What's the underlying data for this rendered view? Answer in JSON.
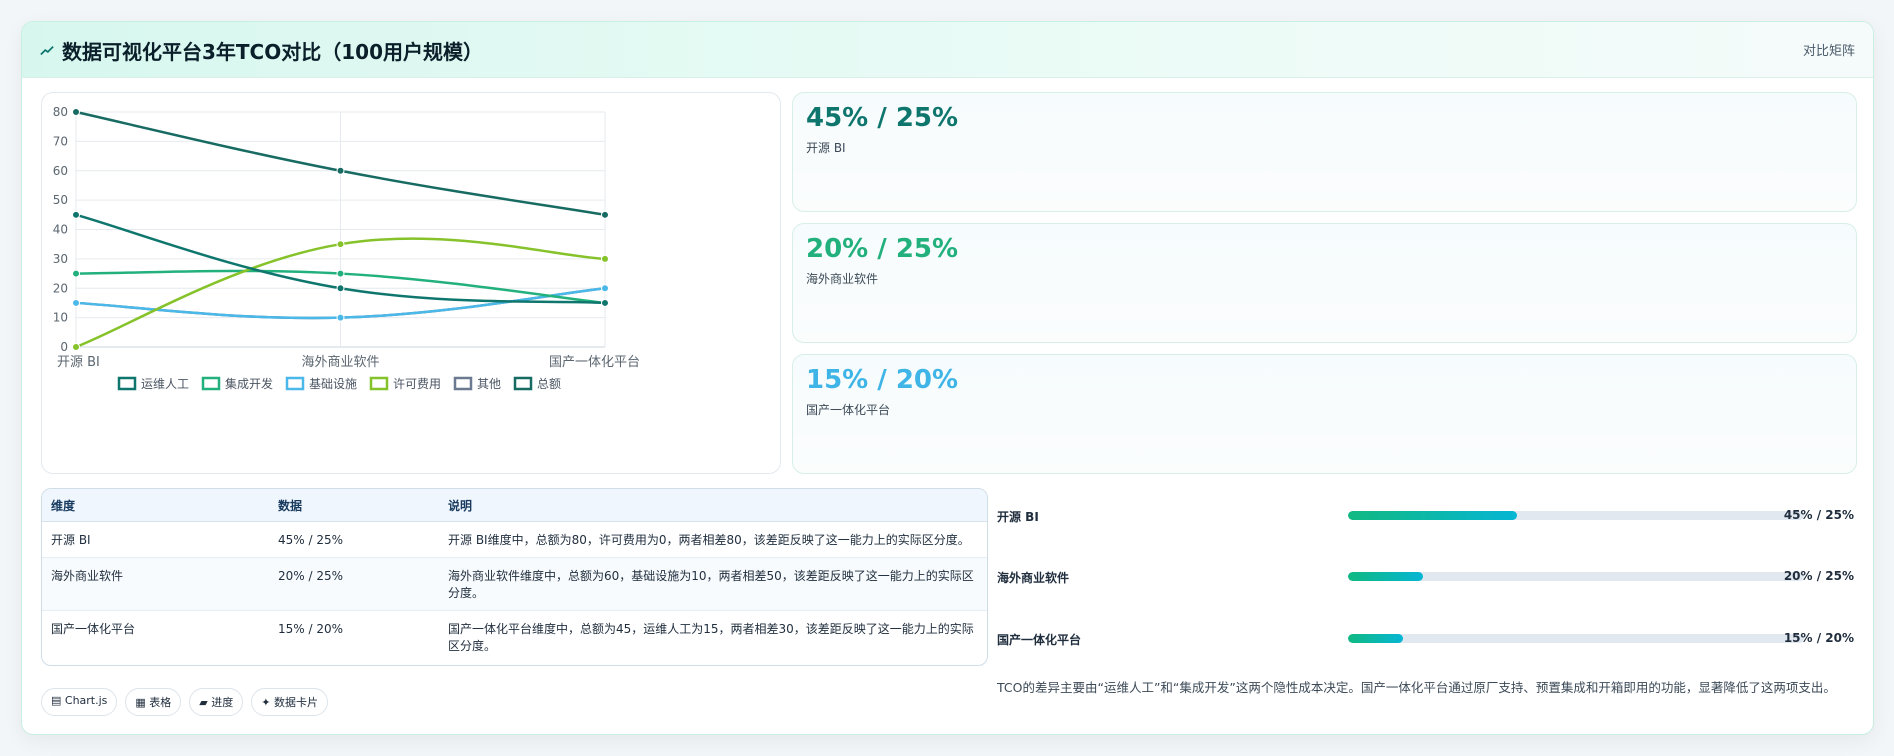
{
  "header": {
    "title": "数据可视化平台3年TCO对比（100用户规模）",
    "right": "对比矩阵",
    "icon": "trend-icon"
  },
  "chart_data": {
    "type": "line",
    "categories": [
      "开源 BI",
      "海外商业软件",
      "国产一体化平台"
    ],
    "ylim": [
      0,
      80
    ],
    "yticks": [
      0,
      10,
      20,
      30,
      40,
      50,
      60,
      70,
      80
    ],
    "grid": true,
    "legend_position": "bottom",
    "series": [
      {
        "name": "运维人工",
        "values": [
          45,
          20,
          15
        ],
        "color": "#0f766e"
      },
      {
        "name": "集成开发",
        "values": [
          25,
          25,
          15
        ],
        "color": "#22b07d"
      },
      {
        "name": "基础设施",
        "values": [
          15,
          10,
          20
        ],
        "color": "#4ab8e8"
      },
      {
        "name": "许可费用",
        "values": [
          0,
          35,
          30
        ],
        "color": "#86c22a"
      },
      {
        "name": "其他",
        "values": [
          15,
          10,
          20
        ],
        "color": "#6b7a90"
      },
      {
        "name": "总额",
        "values": [
          80,
          60,
          45
        ],
        "color": "#176b62"
      }
    ]
  },
  "kpis": [
    {
      "value": "45% / 25%",
      "label": "开源 BI",
      "color": "#0f766e"
    },
    {
      "value": "20% / 25%",
      "label": "海外商业软件",
      "color": "#22b07d"
    },
    {
      "value": "15% / 20%",
      "label": "国产一体化平台",
      "color": "#3fb4e6"
    }
  ],
  "table": {
    "headers": [
      "维度",
      "数据",
      "说明"
    ],
    "rows": [
      [
        "开源 BI",
        "45% / 25%",
        "开源 BI维度中，总额为80，许可费用为0，两者相差80，该差距反映了这一能力上的实际区分度。"
      ],
      [
        "海外商业软件",
        "20% / 25%",
        "海外商业软件维度中，总额为60，基础设施为10，两者相差50，该差距反映了这一能力上的实际区分度。"
      ],
      [
        "国产一体化平台",
        "15% / 20%",
        "国产一体化平台维度中，总额为45，运维人工为15，两者相差30，该差距反映了这一能力上的实际区分度。"
      ]
    ]
  },
  "chips": [
    "▤ Chart.js",
    "▦ 表格",
    "▰ 进度",
    "✦ 数据卡片"
  ],
  "progress": [
    {
      "label": "开源 BI",
      "value": "45% / 25%",
      "fraction": 0.37
    },
    {
      "label": "海外商业软件",
      "value": "20% / 25%",
      "fraction": 0.165
    },
    {
      "label": "国产一体化平台",
      "value": "15% / 20%",
      "fraction": 0.12
    }
  ],
  "note": "TCO的差异主要由“运维人工”和“集成开发”这两个隐性成本决定。国产一体化平台通过原厂支持、预置集成和开箱即用的功能，显著降低了这两项支出。"
}
